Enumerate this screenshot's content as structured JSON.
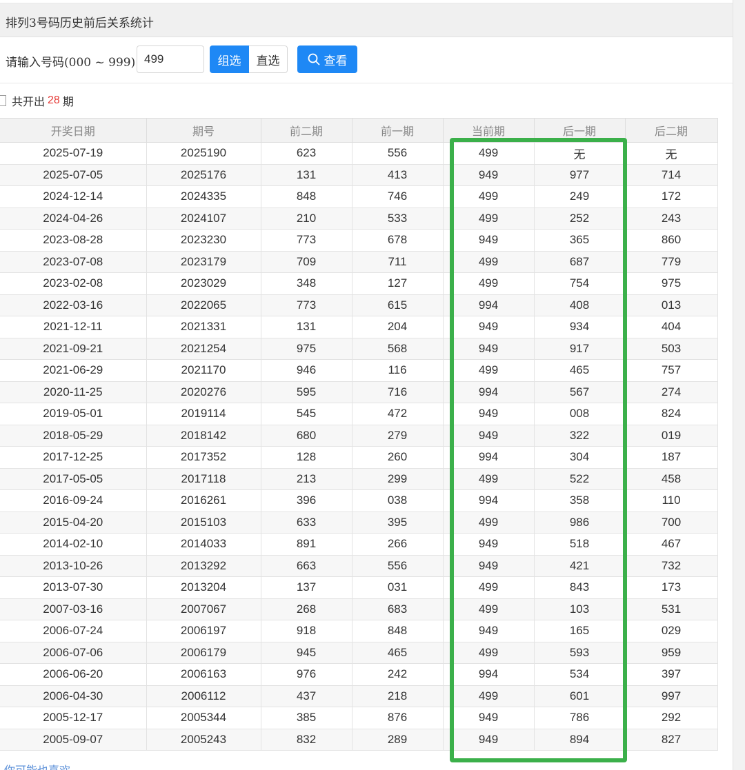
{
  "header": {
    "title": "排列3号码历史前后关系统计"
  },
  "search": {
    "label": "请输入号码(000 ~ 999)：",
    "value": "499",
    "group_label": "组选",
    "direct_label": "直选",
    "view_label": "查看"
  },
  "summary": {
    "prefix": "共开出",
    "count": "28",
    "suffix": "期"
  },
  "table": {
    "columns": [
      "开奖日期",
      "期号",
      "前二期",
      "前一期",
      "当前期",
      "后一期",
      "后二期"
    ],
    "rows": [
      [
        "2025-07-19",
        "2025190",
        "623",
        "556",
        "499",
        "无",
        "无"
      ],
      [
        "2025-07-05",
        "2025176",
        "131",
        "413",
        "949",
        "977",
        "714"
      ],
      [
        "2024-12-14",
        "2024335",
        "848",
        "746",
        "499",
        "249",
        "172"
      ],
      [
        "2024-04-26",
        "2024107",
        "210",
        "533",
        "499",
        "252",
        "243"
      ],
      [
        "2023-08-28",
        "2023230",
        "773",
        "678",
        "949",
        "365",
        "860"
      ],
      [
        "2023-07-08",
        "2023179",
        "709",
        "711",
        "499",
        "687",
        "779"
      ],
      [
        "2023-02-08",
        "2023029",
        "348",
        "127",
        "499",
        "754",
        "975"
      ],
      [
        "2022-03-16",
        "2022065",
        "773",
        "615",
        "994",
        "408",
        "013"
      ],
      [
        "2021-12-11",
        "2021331",
        "131",
        "204",
        "949",
        "934",
        "404"
      ],
      [
        "2021-09-21",
        "2021254",
        "975",
        "568",
        "949",
        "917",
        "503"
      ],
      [
        "2021-06-29",
        "2021170",
        "946",
        "116",
        "499",
        "465",
        "757"
      ],
      [
        "2020-11-25",
        "2020276",
        "595",
        "716",
        "994",
        "567",
        "274"
      ],
      [
        "2019-05-01",
        "2019114",
        "545",
        "472",
        "949",
        "008",
        "824"
      ],
      [
        "2018-05-29",
        "2018142",
        "680",
        "279",
        "949",
        "322",
        "019"
      ],
      [
        "2017-12-25",
        "2017352",
        "128",
        "260",
        "994",
        "304",
        "187"
      ],
      [
        "2017-05-05",
        "2017118",
        "213",
        "299",
        "499",
        "522",
        "458"
      ],
      [
        "2016-09-24",
        "2016261",
        "396",
        "038",
        "994",
        "358",
        "110"
      ],
      [
        "2015-04-20",
        "2015103",
        "633",
        "395",
        "499",
        "986",
        "700"
      ],
      [
        "2014-02-10",
        "2014033",
        "891",
        "266",
        "949",
        "518",
        "467"
      ],
      [
        "2013-10-26",
        "2013292",
        "663",
        "556",
        "949",
        "421",
        "732"
      ],
      [
        "2013-07-30",
        "2013204",
        "137",
        "031",
        "499",
        "843",
        "173"
      ],
      [
        "2007-03-16",
        "2007067",
        "268",
        "683",
        "499",
        "103",
        "531"
      ],
      [
        "2006-07-24",
        "2006197",
        "918",
        "848",
        "949",
        "165",
        "029"
      ],
      [
        "2006-07-06",
        "2006179",
        "945",
        "465",
        "499",
        "593",
        "959"
      ],
      [
        "2006-06-20",
        "2006163",
        "976",
        "242",
        "994",
        "534",
        "397"
      ],
      [
        "2006-04-30",
        "2006112",
        "437",
        "218",
        "499",
        "601",
        "997"
      ],
      [
        "2005-12-17",
        "2005344",
        "385",
        "876",
        "949",
        "786",
        "292"
      ],
      [
        "2005-09-07",
        "2005243",
        "832",
        "289",
        "949",
        "894",
        "827"
      ]
    ]
  },
  "footer": {
    "text": "你可能也喜欢"
  },
  "colors": {
    "accent": "#1e88f5",
    "highlight": "#3bb04a",
    "count": "#e53935"
  },
  "icons": {
    "view_button": "search-icon",
    "summary": "checkbox-icon"
  }
}
